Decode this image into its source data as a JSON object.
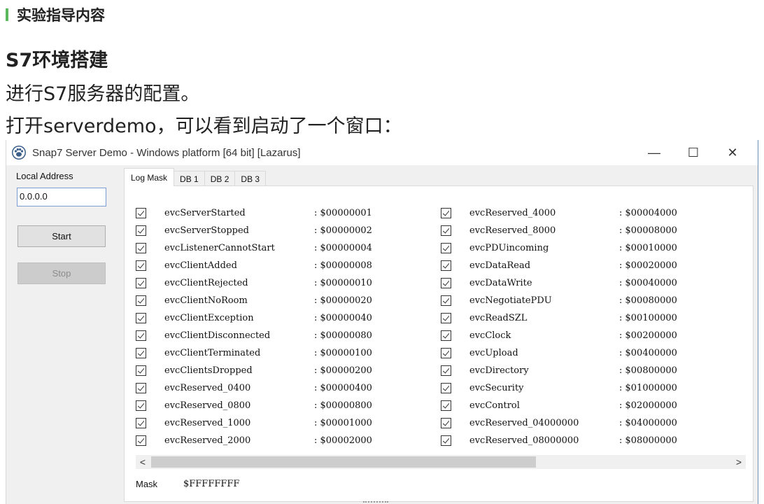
{
  "article": {
    "section_title": "实验指导内容",
    "heading": "S7环境搭建",
    "paragraph1": "进行S7服务器的配置。",
    "paragraph2": "打开serverdemo，可以看到启动了一个窗口：",
    "accent_color": "#5cb85c"
  },
  "window": {
    "title": "Snap7 Server Demo - Windows platform [64 bit] [Lazarus]",
    "icon": "snap7-paw-icon",
    "controls": {
      "minimize": "—",
      "maximize": "☐",
      "close": "✕"
    }
  },
  "left_panel": {
    "local_address_label": "Local Address",
    "local_address_value": "0.0.0.0",
    "start_label": "Start",
    "stop_label": "Stop"
  },
  "tabs": [
    {
      "label": "Log Mask",
      "active": true
    },
    {
      "label": "DB 1",
      "active": false
    },
    {
      "label": "DB 2",
      "active": false
    },
    {
      "label": "DB 3",
      "active": false
    }
  ],
  "log_mask": {
    "left": [
      {
        "name": "evcServerStarted",
        "value": ": $00000001",
        "checked": true
      },
      {
        "name": "evcServerStopped",
        "value": ": $00000002",
        "checked": true
      },
      {
        "name": "evcListenerCannotStart",
        "value": ": $00000004",
        "checked": true
      },
      {
        "name": "evcClientAdded",
        "value": ": $00000008",
        "checked": true
      },
      {
        "name": "evcClientRejected",
        "value": ": $00000010",
        "checked": true
      },
      {
        "name": "evcClientNoRoom",
        "value": ": $00000020",
        "checked": true
      },
      {
        "name": "evcClientException",
        "value": ": $00000040",
        "checked": true
      },
      {
        "name": "evcClientDisconnected",
        "value": ": $00000080",
        "checked": true
      },
      {
        "name": "evcClientTerminated",
        "value": ": $00000100",
        "checked": true
      },
      {
        "name": "evcClientsDropped",
        "value": ": $00000200",
        "checked": true
      },
      {
        "name": "evcReserved_0400",
        "value": ": $00000400",
        "checked": true
      },
      {
        "name": "evcReserved_0800",
        "value": ": $00000800",
        "checked": true
      },
      {
        "name": "evcReserved_1000",
        "value": ": $00001000",
        "checked": true
      },
      {
        "name": "evcReserved_2000",
        "value": ": $00002000",
        "checked": true
      }
    ],
    "right": [
      {
        "name": "evcReserved_4000",
        "value": ": $00004000",
        "checked": true
      },
      {
        "name": "evcReserved_8000",
        "value": ": $00008000",
        "checked": true
      },
      {
        "name": "evcPDUincoming",
        "value": ": $00010000",
        "checked": true
      },
      {
        "name": "evcDataRead",
        "value": ": $00020000",
        "checked": true
      },
      {
        "name": "evcDataWrite",
        "value": ": $00040000",
        "checked": true
      },
      {
        "name": "evcNegotiatePDU",
        "value": ": $00080000",
        "checked": true
      },
      {
        "name": "evcReadSZL",
        "value": ": $00100000",
        "checked": true
      },
      {
        "name": "evcClock",
        "value": ": $00200000",
        "checked": true
      },
      {
        "name": "evcUpload",
        "value": ": $00400000",
        "checked": true
      },
      {
        "name": "evcDirectory",
        "value": ": $00800000",
        "checked": true
      },
      {
        "name": "evcSecurity",
        "value": ": $01000000",
        "checked": true
      },
      {
        "name": "evcControl",
        "value": ": $02000000",
        "checked": true
      },
      {
        "name": "evcReserved_04000000",
        "value": ": $04000000",
        "checked": true
      },
      {
        "name": "evcReserved_08000000",
        "value": ": $08000000",
        "checked": true
      }
    ],
    "scroll_left": "<",
    "scroll_right": ">",
    "mask_label": "Mask",
    "mask_value": "$FFFFFFFF"
  }
}
